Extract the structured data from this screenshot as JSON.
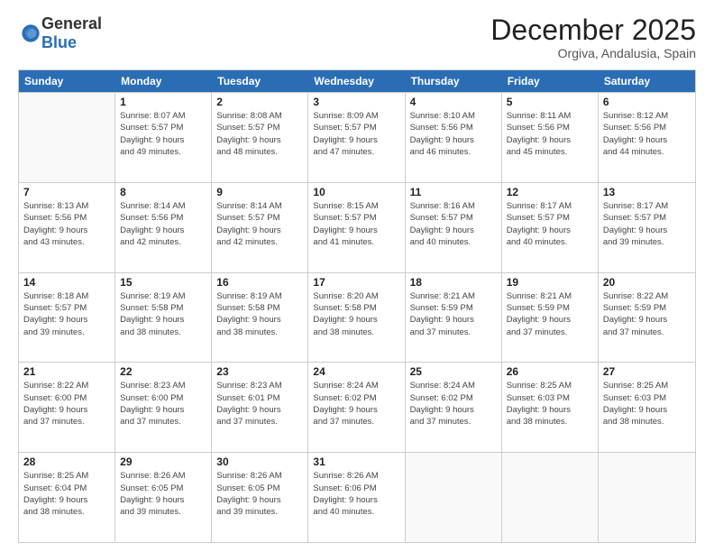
{
  "logo": {
    "general": "General",
    "blue": "Blue"
  },
  "header": {
    "month": "December 2025",
    "location": "Orgiva, Andalusia, Spain"
  },
  "weekdays": [
    "Sunday",
    "Monday",
    "Tuesday",
    "Wednesday",
    "Thursday",
    "Friday",
    "Saturday"
  ],
  "weeks": [
    [
      {
        "day": "",
        "info": ""
      },
      {
        "day": "1",
        "info": "Sunrise: 8:07 AM\nSunset: 5:57 PM\nDaylight: 9 hours\nand 49 minutes."
      },
      {
        "day": "2",
        "info": "Sunrise: 8:08 AM\nSunset: 5:57 PM\nDaylight: 9 hours\nand 48 minutes."
      },
      {
        "day": "3",
        "info": "Sunrise: 8:09 AM\nSunset: 5:57 PM\nDaylight: 9 hours\nand 47 minutes."
      },
      {
        "day": "4",
        "info": "Sunrise: 8:10 AM\nSunset: 5:56 PM\nDaylight: 9 hours\nand 46 minutes."
      },
      {
        "day": "5",
        "info": "Sunrise: 8:11 AM\nSunset: 5:56 PM\nDaylight: 9 hours\nand 45 minutes."
      },
      {
        "day": "6",
        "info": "Sunrise: 8:12 AM\nSunset: 5:56 PM\nDaylight: 9 hours\nand 44 minutes."
      }
    ],
    [
      {
        "day": "7",
        "info": "Sunrise: 8:13 AM\nSunset: 5:56 PM\nDaylight: 9 hours\nand 43 minutes."
      },
      {
        "day": "8",
        "info": "Sunrise: 8:14 AM\nSunset: 5:56 PM\nDaylight: 9 hours\nand 42 minutes."
      },
      {
        "day": "9",
        "info": "Sunrise: 8:14 AM\nSunset: 5:57 PM\nDaylight: 9 hours\nand 42 minutes."
      },
      {
        "day": "10",
        "info": "Sunrise: 8:15 AM\nSunset: 5:57 PM\nDaylight: 9 hours\nand 41 minutes."
      },
      {
        "day": "11",
        "info": "Sunrise: 8:16 AM\nSunset: 5:57 PM\nDaylight: 9 hours\nand 40 minutes."
      },
      {
        "day": "12",
        "info": "Sunrise: 8:17 AM\nSunset: 5:57 PM\nDaylight: 9 hours\nand 40 minutes."
      },
      {
        "day": "13",
        "info": "Sunrise: 8:17 AM\nSunset: 5:57 PM\nDaylight: 9 hours\nand 39 minutes."
      }
    ],
    [
      {
        "day": "14",
        "info": "Sunrise: 8:18 AM\nSunset: 5:57 PM\nDaylight: 9 hours\nand 39 minutes."
      },
      {
        "day": "15",
        "info": "Sunrise: 8:19 AM\nSunset: 5:58 PM\nDaylight: 9 hours\nand 38 minutes."
      },
      {
        "day": "16",
        "info": "Sunrise: 8:19 AM\nSunset: 5:58 PM\nDaylight: 9 hours\nand 38 minutes."
      },
      {
        "day": "17",
        "info": "Sunrise: 8:20 AM\nSunset: 5:58 PM\nDaylight: 9 hours\nand 38 minutes."
      },
      {
        "day": "18",
        "info": "Sunrise: 8:21 AM\nSunset: 5:59 PM\nDaylight: 9 hours\nand 37 minutes."
      },
      {
        "day": "19",
        "info": "Sunrise: 8:21 AM\nSunset: 5:59 PM\nDaylight: 9 hours\nand 37 minutes."
      },
      {
        "day": "20",
        "info": "Sunrise: 8:22 AM\nSunset: 5:59 PM\nDaylight: 9 hours\nand 37 minutes."
      }
    ],
    [
      {
        "day": "21",
        "info": "Sunrise: 8:22 AM\nSunset: 6:00 PM\nDaylight: 9 hours\nand 37 minutes."
      },
      {
        "day": "22",
        "info": "Sunrise: 8:23 AM\nSunset: 6:00 PM\nDaylight: 9 hours\nand 37 minutes."
      },
      {
        "day": "23",
        "info": "Sunrise: 8:23 AM\nSunset: 6:01 PM\nDaylight: 9 hours\nand 37 minutes."
      },
      {
        "day": "24",
        "info": "Sunrise: 8:24 AM\nSunset: 6:02 PM\nDaylight: 9 hours\nand 37 minutes."
      },
      {
        "day": "25",
        "info": "Sunrise: 8:24 AM\nSunset: 6:02 PM\nDaylight: 9 hours\nand 37 minutes."
      },
      {
        "day": "26",
        "info": "Sunrise: 8:25 AM\nSunset: 6:03 PM\nDaylight: 9 hours\nand 38 minutes."
      },
      {
        "day": "27",
        "info": "Sunrise: 8:25 AM\nSunset: 6:03 PM\nDaylight: 9 hours\nand 38 minutes."
      }
    ],
    [
      {
        "day": "28",
        "info": "Sunrise: 8:25 AM\nSunset: 6:04 PM\nDaylight: 9 hours\nand 38 minutes."
      },
      {
        "day": "29",
        "info": "Sunrise: 8:26 AM\nSunset: 6:05 PM\nDaylight: 9 hours\nand 39 minutes."
      },
      {
        "day": "30",
        "info": "Sunrise: 8:26 AM\nSunset: 6:05 PM\nDaylight: 9 hours\nand 39 minutes."
      },
      {
        "day": "31",
        "info": "Sunrise: 8:26 AM\nSunset: 6:06 PM\nDaylight: 9 hours\nand 40 minutes."
      },
      {
        "day": "",
        "info": ""
      },
      {
        "day": "",
        "info": ""
      },
      {
        "day": "",
        "info": ""
      }
    ]
  ]
}
